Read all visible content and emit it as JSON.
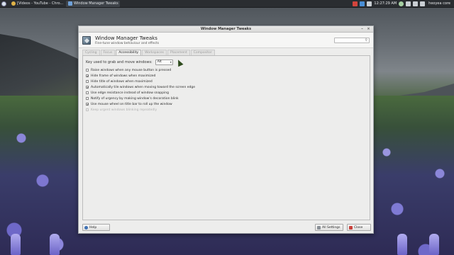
{
  "panel": {
    "tasks": [
      {
        "label": "[Videos - YouTube - Chro..."
      },
      {
        "label": "Window Manager Tweaks"
      }
    ],
    "clock": "12:27:29 AM",
    "user": "heoyea core"
  },
  "window": {
    "title": "Window Manager Tweaks",
    "header_title": "Window Manager Tweaks",
    "header_subtitle": "Fine-tune window behaviour and effects",
    "search_placeholder": ""
  },
  "tabs": [
    {
      "label": "Cycling",
      "active": false
    },
    {
      "label": "Focus",
      "active": false
    },
    {
      "label": "Accessibility",
      "active": true
    },
    {
      "label": "Workspaces",
      "active": false
    },
    {
      "label": "Placement",
      "active": false
    },
    {
      "label": "Compositor",
      "active": false
    }
  ],
  "accessibility": {
    "grab_label": "Key used to grab and move windows:",
    "grab_value": "Alt",
    "options": [
      {
        "label": "Raise windows when any mouse button is pressed",
        "checked": false,
        "enabled": true
      },
      {
        "label": "Hide frame of windows when maximized",
        "checked": true,
        "enabled": true
      },
      {
        "label": "Hide title of windows when maximized",
        "checked": false,
        "enabled": true
      },
      {
        "label": "Automatically tile windows when moving toward the screen edge",
        "checked": true,
        "enabled": true
      },
      {
        "label": "Use edge resistance instead of window snapping",
        "checked": false,
        "enabled": true
      },
      {
        "label": "Notify of urgency by making window's decoration blink",
        "checked": false,
        "enabled": true
      },
      {
        "label": "Use mouse wheel on title bar to roll up the window",
        "checked": true,
        "enabled": true
      },
      {
        "label": "Keep urgent windows blinking repeatedly",
        "checked": false,
        "enabled": false
      }
    ]
  },
  "footer": {
    "help_label": "Help",
    "all_settings_label": "All Settings",
    "close_label": "Close"
  },
  "checkmark": "✔"
}
